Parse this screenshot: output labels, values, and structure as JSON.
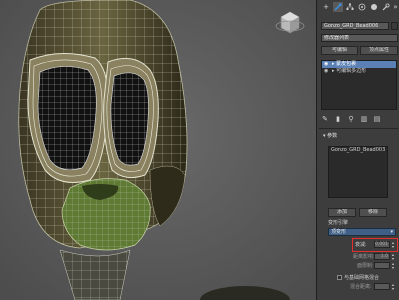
{
  "panel": {
    "toolbar": {
      "plus_glyph": "+",
      "more_glyph": "»"
    },
    "object_name": "Gonzo_GRD_Bead006",
    "modifier_list_label": "修改器列表",
    "buttons": {
      "edit_poly": "可编辑",
      "vertex_property": "顶点属性",
      "button3": "编辑多边形",
      "button4": "路径网格"
    },
    "stack": [
      {
        "label": "▸ 蒙皮包裹",
        "selected": true
      },
      {
        "label": "▸ 可编辑多边形",
        "selected": false
      }
    ],
    "params": {
      "header": "参数",
      "list_item": "Gonzo_GRD_Bead003",
      "add_button": "添加",
      "remove_button": "移除",
      "deform_engine_label": "变形引擎",
      "deform_engine_value": "顶变形",
      "falloff_label": "衰减:",
      "falloff_value": "0.001",
      "distance_label": "距离影响:",
      "distance_value": "1.0",
      "face_limit_label": "面限制:",
      "face_limit_value": "",
      "checkbox_label": "与基础网格混合",
      "blend_label": "混合距离:"
    }
  },
  "colors": {
    "accent_red": "#e53030",
    "selection_blue": "#5a80b5",
    "dropdown_blue": "#3f5f86"
  }
}
